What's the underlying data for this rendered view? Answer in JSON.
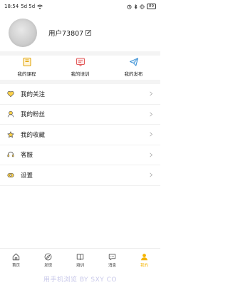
{
  "status_bar": {
    "time": "18:54",
    "signal": "5d 5d",
    "battery": "89"
  },
  "profile": {
    "username": "用户73807"
  },
  "shortcuts": [
    {
      "label": "我的课程",
      "icon": "course-icon"
    },
    {
      "label": "我的培训",
      "icon": "training-icon"
    },
    {
      "label": "我的发布",
      "icon": "publish-icon"
    }
  ],
  "menu": [
    {
      "label": "我的关注",
      "icon": "heart-icon"
    },
    {
      "label": "我的粉丝",
      "icon": "fans-icon"
    },
    {
      "label": "我的收藏",
      "icon": "star-icon"
    },
    {
      "label": "客服",
      "icon": "headset-icon"
    },
    {
      "label": "设置",
      "icon": "settings-icon"
    }
  ],
  "tabbar": [
    {
      "label": "首页",
      "icon": "home-icon"
    },
    {
      "label": "发现",
      "icon": "discover-icon"
    },
    {
      "label": "培训",
      "icon": "book-icon"
    },
    {
      "label": "消息",
      "icon": "message-icon"
    },
    {
      "label": "我的",
      "icon": "profile-icon",
      "active": true
    }
  ],
  "watermark": "用手机浏览 BY SXY CO",
  "colors": {
    "accent": "#f5b400",
    "icon_outline": "#555555"
  }
}
